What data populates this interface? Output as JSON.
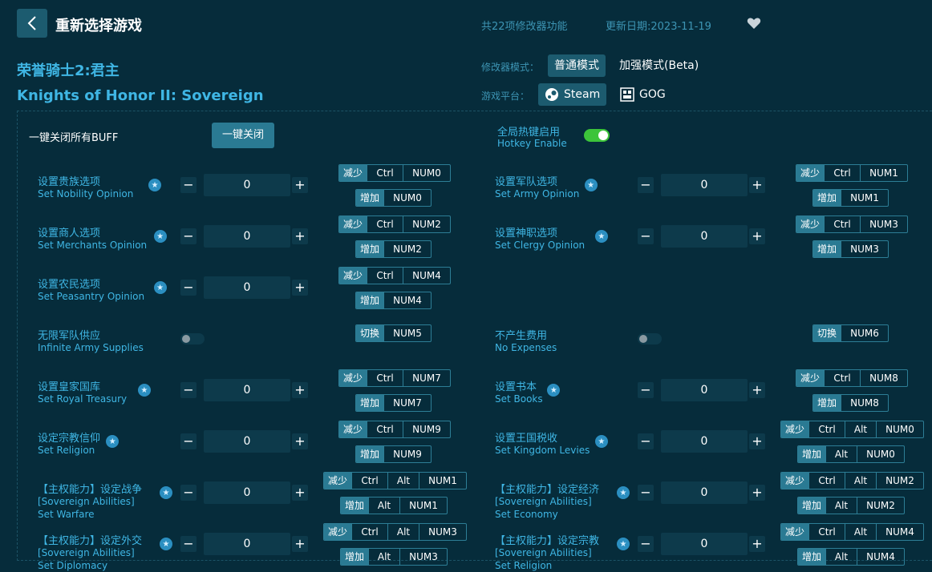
{
  "header": {
    "back_icon": "chevron-left-icon",
    "title": "重新选择游戏",
    "feature_count": "共22项修改器功能",
    "update_date": "更新日期:2023-11-19",
    "favorite_icon": "heart-icon"
  },
  "game": {
    "title_cn": "荣誉骑士2:君主",
    "title_en": "Knights of Honor II: Sovereign"
  },
  "mode": {
    "label": "修改器模式：",
    "normal": "普通模式",
    "enhanced": "加强模式(Beta)"
  },
  "platform": {
    "label": "游戏平台：",
    "steam": "Steam",
    "gog": "GOG"
  },
  "controls": {
    "close_all_label": "一键关闭所有BUFF",
    "close_all_button": "一键关闭",
    "hotkey_cn": "全局热键启用",
    "hotkey_en": "Hotkey Enable"
  },
  "keys": {
    "decrease": "减少",
    "increase": "增加",
    "toggle": "切换",
    "ctrl": "Ctrl",
    "alt": "Alt",
    "plus": "+",
    "minus": "−"
  },
  "items": [
    {
      "cn": "设置贵族选项",
      "en": "Set Nobility Opinion",
      "value": "0",
      "dec": [
        "Ctrl",
        "NUM0"
      ],
      "inc": [
        "NUM0"
      ]
    },
    {
      "cn": "设置军队选项",
      "en": "Set Army Opinion",
      "value": "0",
      "dec": [
        "Ctrl",
        "NUM1"
      ],
      "inc": [
        "NUM1"
      ]
    },
    {
      "cn": "设置商人选项",
      "en": "Set Merchants Opinion",
      "value": "0",
      "dec": [
        "Ctrl",
        "NUM2"
      ],
      "inc": [
        "NUM2"
      ]
    },
    {
      "cn": "设置神职选项",
      "en": "Set Clergy Opinion",
      "value": "0",
      "dec": [
        "Ctrl",
        "NUM3"
      ],
      "inc": [
        "NUM3"
      ]
    },
    {
      "cn": "设置农民选项",
      "en": "Set Peasantry Opinion",
      "value": "0",
      "dec": [
        "Ctrl",
        "NUM4"
      ],
      "inc": [
        "NUM4"
      ]
    },
    {
      "cn": "无限军队供应",
      "en": "Infinite Army Supplies",
      "toggle_key": "NUM5"
    },
    {
      "cn": "不产生费用",
      "en": "No Expenses",
      "toggle_key": "NUM6"
    },
    {
      "cn": "设置皇家国库",
      "en": "Set Royal Treasury",
      "value": "0",
      "dec": [
        "Ctrl",
        "NUM7"
      ],
      "inc": [
        "NUM7"
      ]
    },
    {
      "cn": "设置书本",
      "en": "Set Books",
      "value": "0",
      "dec": [
        "Ctrl",
        "NUM8"
      ],
      "inc": [
        "NUM8"
      ]
    },
    {
      "cn": "设定宗教信仰",
      "en": "Set Religion",
      "value": "0",
      "dec": [
        "Ctrl",
        "NUM9"
      ],
      "inc": [
        "NUM9"
      ]
    },
    {
      "cn": "设置王国税收",
      "en": "Set Kingdom Levies",
      "value": "0",
      "dec": [
        "Ctrl",
        "Alt",
        "NUM0"
      ],
      "inc": [
        "Alt",
        "NUM0"
      ]
    },
    {
      "cn": "【主权能力】设定战争",
      "en": "[Sovereign Abilities] Set Warfare",
      "value": "0",
      "dec": [
        "Ctrl",
        "Alt",
        "NUM1"
      ],
      "inc": [
        "Alt",
        "NUM1"
      ]
    },
    {
      "cn": "【主权能力】设定经济",
      "en": "[Sovereign Abilities] Set Economy",
      "value": "0",
      "dec": [
        "Ctrl",
        "Alt",
        "NUM2"
      ],
      "inc": [
        "Alt",
        "NUM2"
      ]
    },
    {
      "cn": "【主权能力】设定外交",
      "en": "[Sovereign Abilities] Set Diplomacy",
      "value": "0",
      "dec": [
        "Ctrl",
        "Alt",
        "NUM3"
      ],
      "inc": [
        "Alt",
        "NUM3"
      ]
    },
    {
      "cn": "【主权能力】设定宗教",
      "en": "[Sovereign Abilities] Set Religion",
      "value": "0",
      "dec": [
        "Ctrl",
        "Alt",
        "NUM4"
      ],
      "inc": [
        "Alt",
        "NUM4"
      ]
    }
  ]
}
